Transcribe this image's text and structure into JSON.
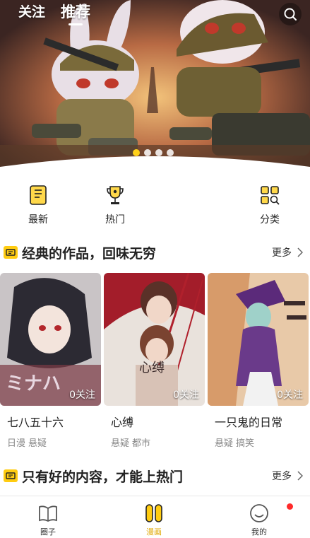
{
  "header": {
    "tabs": [
      {
        "label": "关注",
        "active": false
      },
      {
        "label": "推荐",
        "active": true
      }
    ],
    "search_icon": "search-icon"
  },
  "banner": {
    "slides": 4,
    "active_slide": 0
  },
  "quick_entries": [
    {
      "label": "最新",
      "icon": "book-icon"
    },
    {
      "label": "热门",
      "icon": "trophy-icon"
    },
    {
      "label": "分类",
      "icon": "category-search-icon"
    }
  ],
  "sections": [
    {
      "title": "经典的作品，回味无穷",
      "more": "更多"
    },
    {
      "title": "只有好的内容，才能上热门",
      "more": "更多"
    }
  ],
  "comics": [
    {
      "title": "七八五十六",
      "follow": "0关注",
      "tags": [
        "日漫",
        "悬疑"
      ],
      "cover_text": "ミナハ"
    },
    {
      "title": "心缚",
      "follow": "0关注",
      "tags": [
        "悬疑",
        "都市"
      ],
      "cover_text": "心缚"
    },
    {
      "title": "一只鬼的日常",
      "follow": "0关注",
      "tags": [
        "悬疑",
        "搞笑"
      ]
    }
  ],
  "bottom_nav": [
    {
      "label": "圈子",
      "icon": "book-open-icon",
      "active": false
    },
    {
      "label": "漫画",
      "icon": "comic-icon",
      "active": true
    },
    {
      "label": "我的",
      "icon": "smile-icon",
      "active": false
    }
  ],
  "colors": {
    "accent": "#ffcc11",
    "active_nav": "#e0a800",
    "notify": "#ff2a2a"
  }
}
